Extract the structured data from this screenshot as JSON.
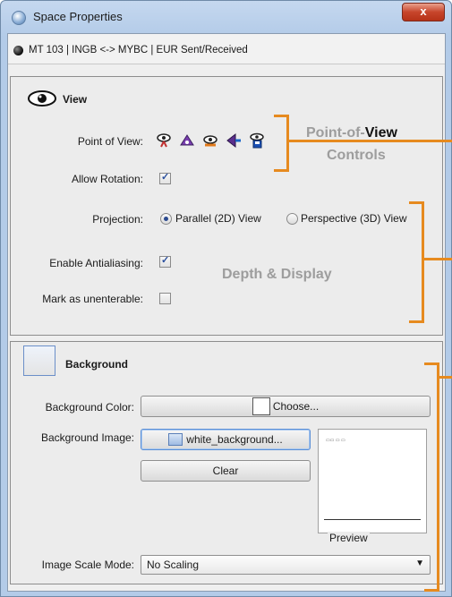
{
  "window": {
    "title": "Space Properties",
    "close_label": "x"
  },
  "info_bar": {
    "text": "MT 103 | INGB <-> MYBC | EUR Sent/Received"
  },
  "view_panel": {
    "title": "View",
    "point_of_view_label": "Point of View:",
    "allow_rotation_label": "Allow Rotation:",
    "allow_rotation_checked": true,
    "projection_label": "Projection:",
    "projection_options": [
      "Parallel (2D) View",
      "Perspective (3D) View"
    ],
    "projection_selected": "Parallel (2D) View",
    "antialiasing_label": "Enable Antialiasing:",
    "antialiasing_checked": true,
    "unenterable_label": "Mark as unenterable:",
    "unenterable_checked": false,
    "pov_icons": [
      "eye-top-icon",
      "eye-front-icon",
      "eye-side-icon",
      "eye-back-icon",
      "eye-save-icon"
    ]
  },
  "annotations": {
    "pov_line1_part1": "Point-of-",
    "pov_line1_part2": "View",
    "pov_line2": "Controls",
    "depth": "Depth & Display",
    "accent_color": "#e68a1f"
  },
  "background_panel": {
    "title": "Background",
    "color_label": "Background Color:",
    "choose_label": "Choose...",
    "image_label": "Background Image:",
    "image_button_label": "white_background...",
    "clear_label": "Clear",
    "preview_label": "Preview",
    "scale_mode_label": "Image Scale Mode:",
    "scale_mode_value": "No Scaling"
  }
}
